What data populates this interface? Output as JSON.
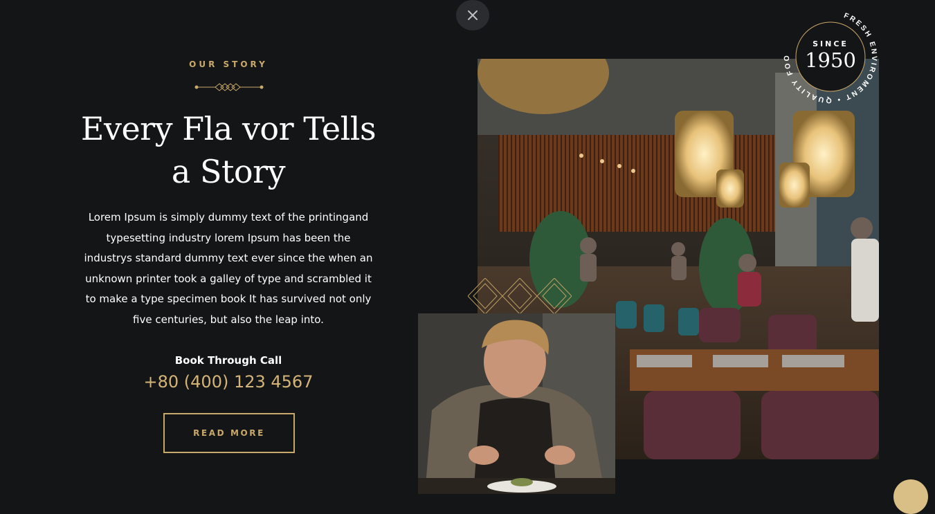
{
  "close": {
    "icon": "close-icon"
  },
  "story": {
    "eyebrow": "OUR STORY",
    "headline": "Every Fla vor Tells a Story",
    "body": "Lorem Ipsum is simply dummy text of the printingand typesetting industry lorem Ipsum has been the industrys standard dummy text ever since the when an unknown printer took a galley of type and scrambled it to make a type specimen book It has survived not only five centuries, but also the leap into.",
    "book_label": "Book Through Call",
    "phone": "+80 (400) 123 4567",
    "read_more": "READ MORE"
  },
  "badge": {
    "circular_text": "FRESH ENVIROMENT • QUALITY FOOD •",
    "since": "SINCE",
    "year": "1950"
  },
  "colors": {
    "background": "#141517",
    "accent": "#c9a96a"
  }
}
